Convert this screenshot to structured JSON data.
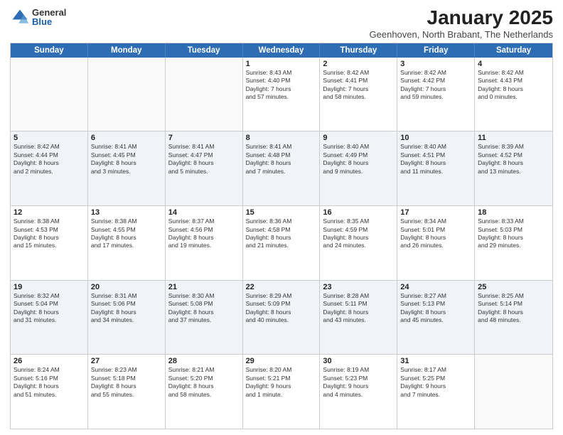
{
  "logo": {
    "general": "General",
    "blue": "Blue"
  },
  "title": "January 2025",
  "subtitle": "Geenhoven, North Brabant, The Netherlands",
  "headers": [
    "Sunday",
    "Monday",
    "Tuesday",
    "Wednesday",
    "Thursday",
    "Friday",
    "Saturday"
  ],
  "rows": [
    [
      {
        "day": "",
        "lines": [],
        "empty": true
      },
      {
        "day": "",
        "lines": [],
        "empty": true
      },
      {
        "day": "",
        "lines": [],
        "empty": true
      },
      {
        "day": "1",
        "lines": [
          "Sunrise: 8:43 AM",
          "Sunset: 4:40 PM",
          "Daylight: 7 hours",
          "and 57 minutes."
        ],
        "empty": false
      },
      {
        "day": "2",
        "lines": [
          "Sunrise: 8:42 AM",
          "Sunset: 4:41 PM",
          "Daylight: 7 hours",
          "and 58 minutes."
        ],
        "empty": false
      },
      {
        "day": "3",
        "lines": [
          "Sunrise: 8:42 AM",
          "Sunset: 4:42 PM",
          "Daylight: 7 hours",
          "and 59 minutes."
        ],
        "empty": false
      },
      {
        "day": "4",
        "lines": [
          "Sunrise: 8:42 AM",
          "Sunset: 4:43 PM",
          "Daylight: 8 hours",
          "and 0 minutes."
        ],
        "empty": false
      }
    ],
    [
      {
        "day": "5",
        "lines": [
          "Sunrise: 8:42 AM",
          "Sunset: 4:44 PM",
          "Daylight: 8 hours",
          "and 2 minutes."
        ],
        "empty": false
      },
      {
        "day": "6",
        "lines": [
          "Sunrise: 8:41 AM",
          "Sunset: 4:45 PM",
          "Daylight: 8 hours",
          "and 3 minutes."
        ],
        "empty": false
      },
      {
        "day": "7",
        "lines": [
          "Sunrise: 8:41 AM",
          "Sunset: 4:47 PM",
          "Daylight: 8 hours",
          "and 5 minutes."
        ],
        "empty": false
      },
      {
        "day": "8",
        "lines": [
          "Sunrise: 8:41 AM",
          "Sunset: 4:48 PM",
          "Daylight: 8 hours",
          "and 7 minutes."
        ],
        "empty": false
      },
      {
        "day": "9",
        "lines": [
          "Sunrise: 8:40 AM",
          "Sunset: 4:49 PM",
          "Daylight: 8 hours",
          "and 9 minutes."
        ],
        "empty": false
      },
      {
        "day": "10",
        "lines": [
          "Sunrise: 8:40 AM",
          "Sunset: 4:51 PM",
          "Daylight: 8 hours",
          "and 11 minutes."
        ],
        "empty": false
      },
      {
        "day": "11",
        "lines": [
          "Sunrise: 8:39 AM",
          "Sunset: 4:52 PM",
          "Daylight: 8 hours",
          "and 13 minutes."
        ],
        "empty": false
      }
    ],
    [
      {
        "day": "12",
        "lines": [
          "Sunrise: 8:38 AM",
          "Sunset: 4:53 PM",
          "Daylight: 8 hours",
          "and 15 minutes."
        ],
        "empty": false
      },
      {
        "day": "13",
        "lines": [
          "Sunrise: 8:38 AM",
          "Sunset: 4:55 PM",
          "Daylight: 8 hours",
          "and 17 minutes."
        ],
        "empty": false
      },
      {
        "day": "14",
        "lines": [
          "Sunrise: 8:37 AM",
          "Sunset: 4:56 PM",
          "Daylight: 8 hours",
          "and 19 minutes."
        ],
        "empty": false
      },
      {
        "day": "15",
        "lines": [
          "Sunrise: 8:36 AM",
          "Sunset: 4:58 PM",
          "Daylight: 8 hours",
          "and 21 minutes."
        ],
        "empty": false
      },
      {
        "day": "16",
        "lines": [
          "Sunrise: 8:35 AM",
          "Sunset: 4:59 PM",
          "Daylight: 8 hours",
          "and 24 minutes."
        ],
        "empty": false
      },
      {
        "day": "17",
        "lines": [
          "Sunrise: 8:34 AM",
          "Sunset: 5:01 PM",
          "Daylight: 8 hours",
          "and 26 minutes."
        ],
        "empty": false
      },
      {
        "day": "18",
        "lines": [
          "Sunrise: 8:33 AM",
          "Sunset: 5:03 PM",
          "Daylight: 8 hours",
          "and 29 minutes."
        ],
        "empty": false
      }
    ],
    [
      {
        "day": "19",
        "lines": [
          "Sunrise: 8:32 AM",
          "Sunset: 5:04 PM",
          "Daylight: 8 hours",
          "and 31 minutes."
        ],
        "empty": false
      },
      {
        "day": "20",
        "lines": [
          "Sunrise: 8:31 AM",
          "Sunset: 5:06 PM",
          "Daylight: 8 hours",
          "and 34 minutes."
        ],
        "empty": false
      },
      {
        "day": "21",
        "lines": [
          "Sunrise: 8:30 AM",
          "Sunset: 5:08 PM",
          "Daylight: 8 hours",
          "and 37 minutes."
        ],
        "empty": false
      },
      {
        "day": "22",
        "lines": [
          "Sunrise: 8:29 AM",
          "Sunset: 5:09 PM",
          "Daylight: 8 hours",
          "and 40 minutes."
        ],
        "empty": false
      },
      {
        "day": "23",
        "lines": [
          "Sunrise: 8:28 AM",
          "Sunset: 5:11 PM",
          "Daylight: 8 hours",
          "and 43 minutes."
        ],
        "empty": false
      },
      {
        "day": "24",
        "lines": [
          "Sunrise: 8:27 AM",
          "Sunset: 5:13 PM",
          "Daylight: 8 hours",
          "and 45 minutes."
        ],
        "empty": false
      },
      {
        "day": "25",
        "lines": [
          "Sunrise: 8:25 AM",
          "Sunset: 5:14 PM",
          "Daylight: 8 hours",
          "and 48 minutes."
        ],
        "empty": false
      }
    ],
    [
      {
        "day": "26",
        "lines": [
          "Sunrise: 8:24 AM",
          "Sunset: 5:16 PM",
          "Daylight: 8 hours",
          "and 51 minutes."
        ],
        "empty": false
      },
      {
        "day": "27",
        "lines": [
          "Sunrise: 8:23 AM",
          "Sunset: 5:18 PM",
          "Daylight: 8 hours",
          "and 55 minutes."
        ],
        "empty": false
      },
      {
        "day": "28",
        "lines": [
          "Sunrise: 8:21 AM",
          "Sunset: 5:20 PM",
          "Daylight: 8 hours",
          "and 58 minutes."
        ],
        "empty": false
      },
      {
        "day": "29",
        "lines": [
          "Sunrise: 8:20 AM",
          "Sunset: 5:21 PM",
          "Daylight: 9 hours",
          "and 1 minute."
        ],
        "empty": false
      },
      {
        "day": "30",
        "lines": [
          "Sunrise: 8:19 AM",
          "Sunset: 5:23 PM",
          "Daylight: 9 hours",
          "and 4 minutes."
        ],
        "empty": false
      },
      {
        "day": "31",
        "lines": [
          "Sunrise: 8:17 AM",
          "Sunset: 5:25 PM",
          "Daylight: 9 hours",
          "and 7 minutes."
        ],
        "empty": false
      },
      {
        "day": "",
        "lines": [],
        "empty": true
      }
    ]
  ]
}
